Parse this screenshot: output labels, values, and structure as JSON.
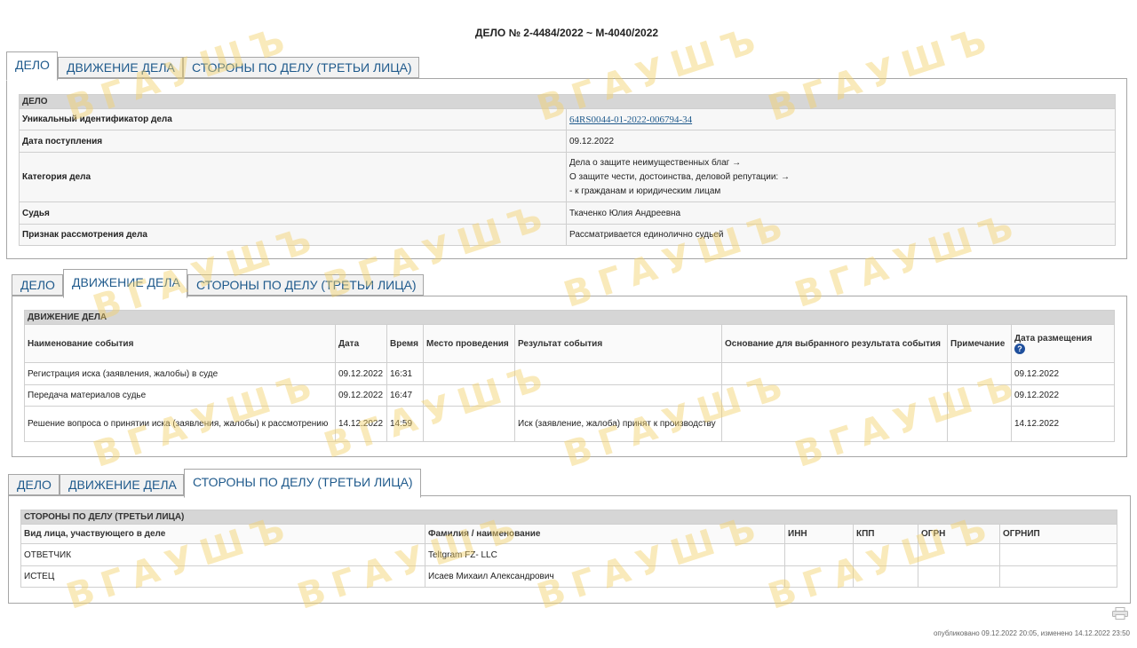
{
  "page_title": "ДЕЛО № 2-4484/2022 ~ М-4040/2022",
  "watermark": "ВГАУШЪ",
  "tabs": [
    "ДЕЛО",
    "ДВИЖЕНИЕ ДЕЛА",
    "СТОРОНЫ ПО ДЕЛУ (ТРЕТЬИ ЛИЦА)"
  ],
  "case": {
    "section_title": "ДЕЛО",
    "rows": [
      {
        "label": "Уникальный идентификатор дела",
        "value": "64RS0044-01-2022-006794-34"
      },
      {
        "label": "Дата поступления",
        "value": "09.12.2022"
      },
      {
        "label": "Категория дела",
        "lines": [
          "Дела о защите неимущественных благ →",
          "О защите чести, достоинства, деловой репутации: →",
          "- к гражданам и юридическим лицам"
        ]
      },
      {
        "label": "Судья",
        "value": "Ткаченко Юлия Андреевна"
      },
      {
        "label": "Признак рассмотрения дела",
        "value": "Рассматривается единолично судьей"
      }
    ]
  },
  "movement": {
    "section_title": "ДВИЖЕНИЕ ДЕЛА",
    "columns": [
      "Наименование события",
      "Дата",
      "Время",
      "Место проведения",
      "Результат события",
      "Основание для выбранного результата события",
      "Примечание",
      "Дата размещения"
    ],
    "rows": [
      [
        "Регистрация иска (заявления, жалобы) в суде",
        "09.12.2022",
        "16:31",
        "",
        "",
        "",
        "",
        "09.12.2022"
      ],
      [
        "Передача материалов судье",
        "09.12.2022",
        "16:47",
        "",
        "",
        "",
        "",
        "09.12.2022"
      ],
      [
        "Решение вопроса о принятии иска (заявления, жалобы) к рассмотрению",
        "14.12.2022",
        "14:59",
        "",
        "Иск (заявление, жалоба) принят к производству",
        "",
        "",
        "14.12.2022"
      ]
    ]
  },
  "parties": {
    "section_title": "СТОРОНЫ ПО ДЕЛУ (ТРЕТЬИ ЛИЦА)",
    "columns": [
      "Вид лица, участвующего в деле",
      "Фамилия / наименование",
      "ИНН",
      "КПП",
      "ОГРН",
      "ОГРНИП"
    ],
    "rows": [
      [
        "ОТВЕТЧИК",
        "Teltgram FZ- LLC",
        "",
        "",
        "",
        ""
      ],
      [
        "ИСТЕЦ",
        "Исаев Михаил Александрович",
        "",
        "",
        "",
        ""
      ]
    ]
  },
  "icons": {
    "help": "help-icon",
    "print": "print-icon"
  },
  "help_glyph": "?",
  "footer": "опубликовано 09.12.2022 20:05, изменено 14.12.2022 23:50"
}
